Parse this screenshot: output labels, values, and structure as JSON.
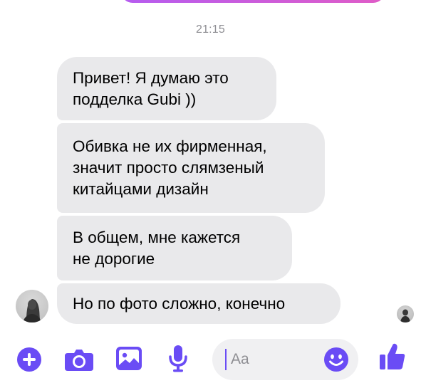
{
  "chat": {
    "timestamp": "21:15",
    "messages": [
      {
        "text": "Привет! Я думаю это\nподделка Gubi ))"
      },
      {
        "text": "Обивка не их фирменная,\nзначит просто слямзеный\nкитайцами дизайн"
      },
      {
        "text": "В общем, мне кажется\nне дорогие"
      },
      {
        "text": "Но по фото сложно, конечно"
      }
    ]
  },
  "composer": {
    "placeholder": "Aa",
    "icons": [
      "plus-icon",
      "camera-icon",
      "gallery-icon",
      "microphone-icon",
      "emoji-icon",
      "thumbs-up-icon"
    ]
  },
  "colors": {
    "accent": "#6a4cf5",
    "bubble": "#e9e9eb",
    "timestamp": "#8e8e93",
    "input_bg": "#f0f0f2"
  }
}
